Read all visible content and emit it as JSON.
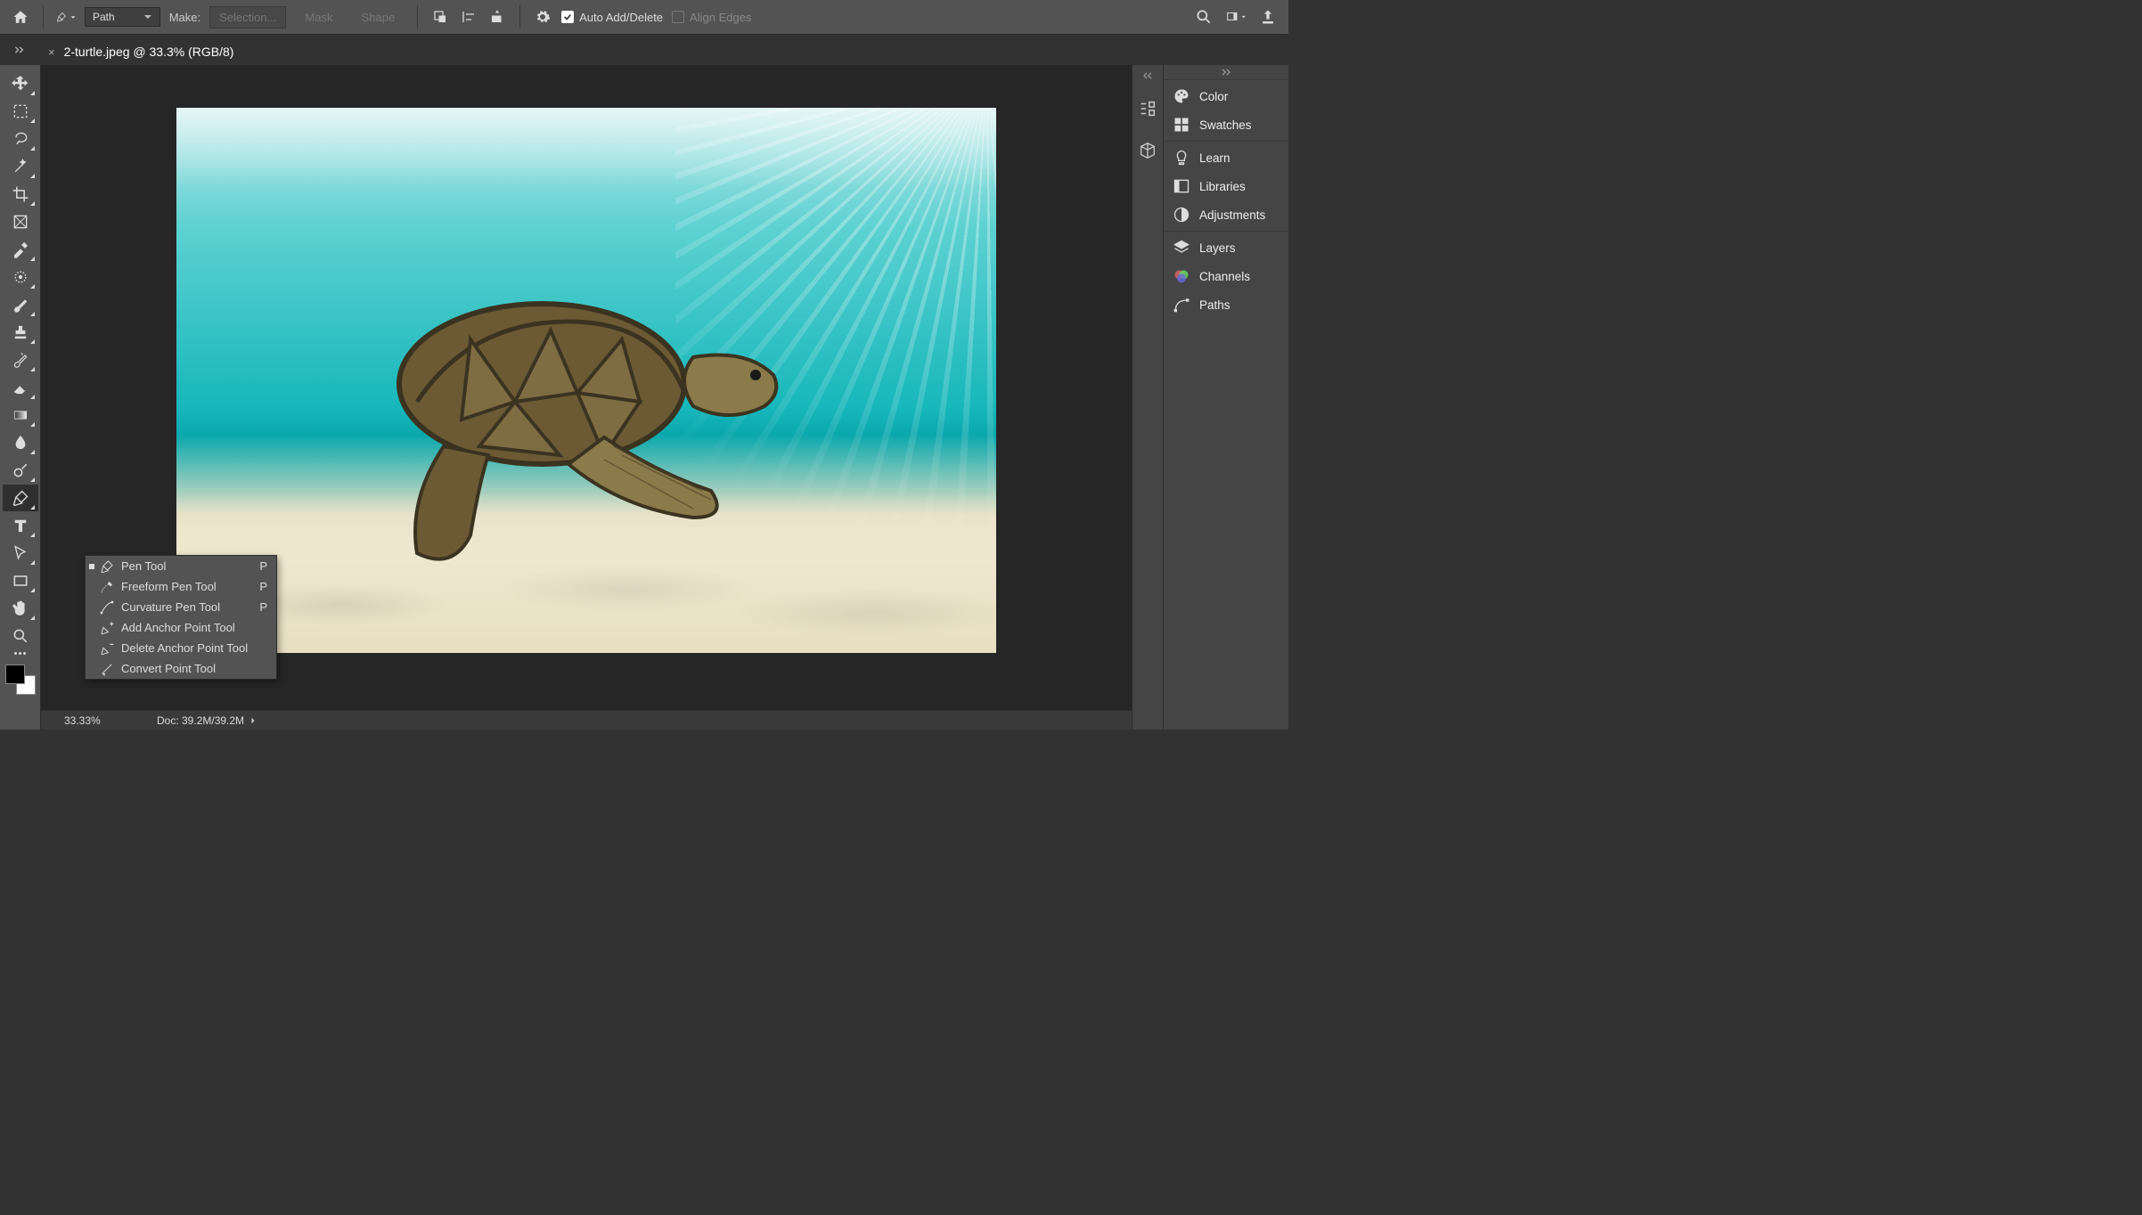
{
  "top": {
    "mode_dropdown": "Path",
    "make_label": "Make:",
    "selection_btn": "Selection...",
    "mask_btn": "Mask",
    "shape_btn": "Shape",
    "auto_add_delete": "Auto Add/Delete",
    "align_edges": "Align Edges"
  },
  "doc": {
    "tab_label": "2-turtle.jpeg @ 33.3% (RGB/8)"
  },
  "pen_popout": {
    "pen_tool": "Pen Tool",
    "freeform_pen_tool": "Freeform Pen Tool",
    "curvature_pen_tool": "Curvature Pen Tool",
    "add_anchor": "Add Anchor Point Tool",
    "delete_anchor": "Delete Anchor Point Tool",
    "convert_point": "Convert Point Tool",
    "sc_p": "P"
  },
  "status": {
    "zoom": "33.33%",
    "doc_size": "Doc: 39.2M/39.2M"
  },
  "rpanel": {
    "color": "Color",
    "swatches": "Swatches",
    "learn": "Learn",
    "libraries": "Libraries",
    "adjustments": "Adjustments",
    "layers": "Layers",
    "channels": "Channels",
    "paths": "Paths"
  }
}
